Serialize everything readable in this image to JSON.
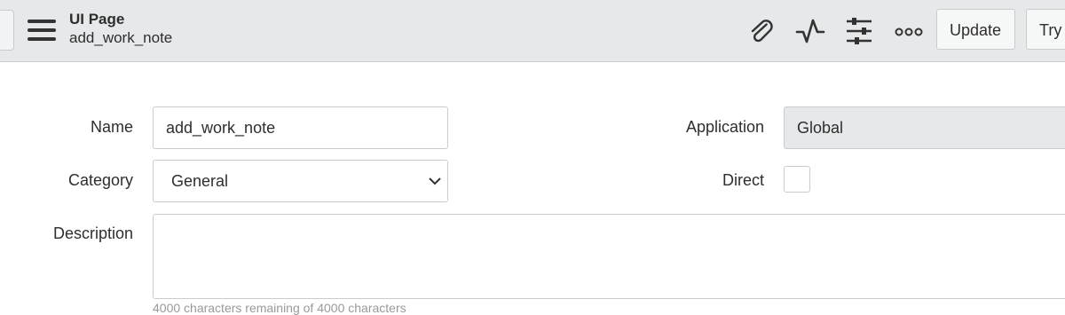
{
  "header": {
    "record_type": "UI Page",
    "record_name": "add_work_note",
    "icons": [
      "paperclip-icon",
      "activity-icon",
      "sliders-icon",
      "more-options-icon"
    ],
    "update_label": "Update",
    "try_label": "Try"
  },
  "form": {
    "name": {
      "label": "Name",
      "value": "add_work_note"
    },
    "category": {
      "label": "Category",
      "value": "General"
    },
    "description": {
      "label": "Description",
      "value": ""
    },
    "application": {
      "label": "Application",
      "value": "Global"
    },
    "direct": {
      "label": "Direct",
      "checked": false
    },
    "char_counter": "4000 characters remaining of 4000 characters"
  },
  "colors": {
    "header_bg": "#e6e8ea",
    "border": "#c9cccf",
    "text": "#2e2e2e",
    "readonly_bg": "#e6e8ea"
  }
}
